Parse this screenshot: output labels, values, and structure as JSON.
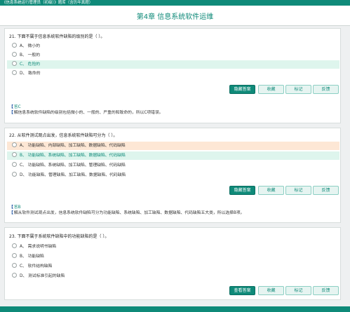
{
  "topbar": {
    "title": "《信息系统运行管理员（初级）》题库（含历年真题）"
  },
  "chapter": {
    "title": "第4章   信息系统软件运维"
  },
  "questions": [
    {
      "stem": "21. 下面不属于信息系统软件缺陷的级别的是（     ）。",
      "options": [
        {
          "label": "A、 微小的",
          "state": "normal"
        },
        {
          "label": "B、 一般的",
          "state": "normal"
        },
        {
          "label": "C、 危险的",
          "state": "correct"
        },
        {
          "label": "D、 致命的",
          "state": "normal"
        }
      ],
      "buttons": [
        "隐藏答案",
        "收藏",
        "标记",
        "反馈"
      ],
      "answer_label": "答C",
      "analysis": "解信息系统软件缺陷的级别包括微小的、一般的、严重的和致命的，所以C项错误。"
    },
    {
      "stem": "22. 从软件测试观点出发，信息系统软件缺陷可分为（      ）。",
      "options": [
        {
          "label": "A、 功能缺陷、内部缺陷、加工缺陷、数据缺陷、代码缺陷",
          "state": "wrong"
        },
        {
          "label": "B、 功能缺陷、系统缺陷、加工缺陷、数据缺陷、代码缺陷",
          "state": "correct"
        },
        {
          "label": "C、 功能缺陷、系统缺陷、加工缺陷、管理缺陷、代码缺陷",
          "state": "normal"
        },
        {
          "label": "D、 功能缺陷、管理缺陷、加工缺陷、数据缺陷、代码缺陷",
          "state": "normal"
        }
      ],
      "buttons": [
        "隐藏答案",
        "收藏",
        "标记",
        "反馈"
      ],
      "answer_label": "答B",
      "analysis": "解从软件测试观点出发，信息系统软件缺陷可分为功能缺陷、系统缺陷、加工缺陷、数据缺陷、代码缺陷五大类，所以选择B项。"
    },
    {
      "stem": "23. 下面不属于系统软件缺陷中的功能缺陷的是（      ）。",
      "options": [
        {
          "label": "A、 需求说明书缺陷",
          "state": "normal"
        },
        {
          "label": "B、 功能缺陷",
          "state": "normal"
        },
        {
          "label": "C、 软件结构缺陷",
          "state": "normal"
        },
        {
          "label": "D、 测试标准引起的缺陷",
          "state": "normal"
        }
      ],
      "buttons": [
        "查看答案",
        "收藏",
        "标记",
        "反馈"
      ]
    }
  ],
  "colors": {
    "brand": "#0f8a79",
    "correct_bg": "#def5ed",
    "wrong_bg": "#fde7d5"
  }
}
